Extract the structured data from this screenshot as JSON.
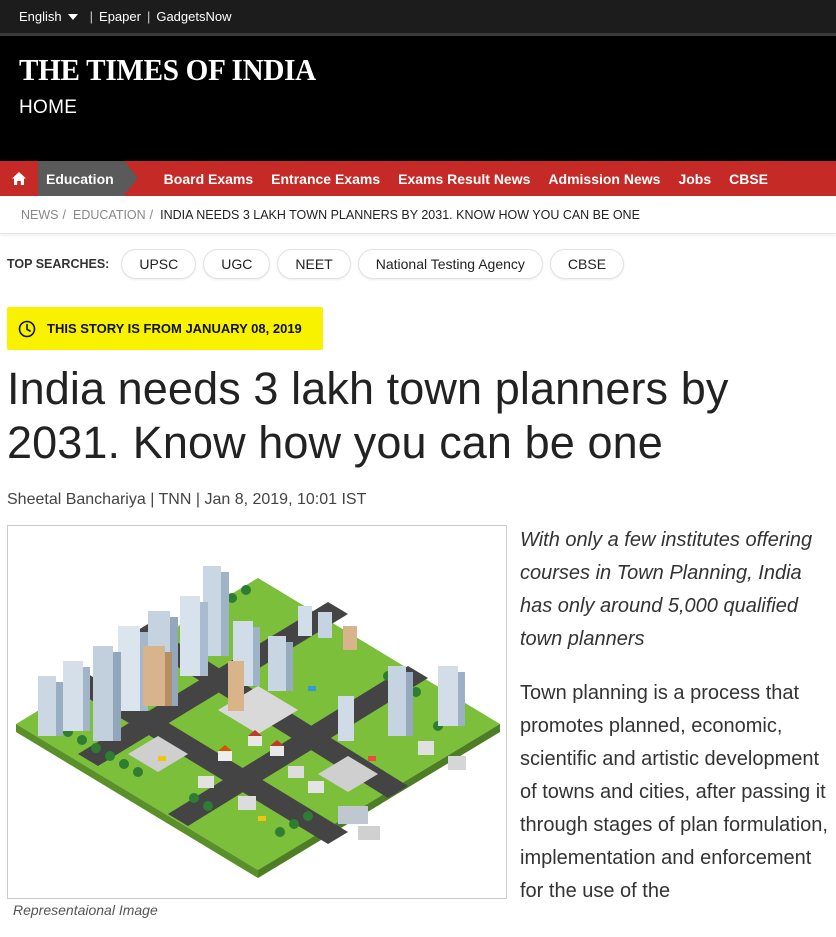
{
  "utilbar": {
    "language": "English",
    "links": [
      "Epaper",
      "GadgetsNow"
    ]
  },
  "masthead": {
    "logo": "THE TIMES OF INDIA",
    "section": "HOME"
  },
  "nav": {
    "active": "Education",
    "items": [
      "Board Exams",
      "Entrance Exams",
      "Exams Result News",
      "Admission News",
      "Jobs",
      "CBSE"
    ]
  },
  "breadcrumb": {
    "items": [
      "NEWS",
      "EDUCATION"
    ],
    "current": "INDIA NEEDS 3 LAKH TOWN PLANNERS BY 2031. KNOW HOW YOU CAN BE ONE"
  },
  "top_searches": {
    "label": "TOP SEARCHES:",
    "items": [
      "UPSC",
      "UGC",
      "NEET",
      "National Testing Agency",
      "CBSE"
    ]
  },
  "story_date": "THIS STORY IS FROM JANUARY 08, 2019",
  "article": {
    "headline": "India needs 3 lakh town planners by 2031. Know how you can be one",
    "byline": "Sheetal Banchariya | TNN | Jan 8, 2019, 10:01 IST",
    "image_caption": "Representaional Image",
    "synopsis": "With only a few institutes offering courses in Town Planning, India has only around 5,000 qualified town planners",
    "body": "Town planning is a process that promotes planned, economic, scientific and artistic development of towns and cities, after passing it through stages of plan formulation, implementation and enforcement for the use of the"
  },
  "colors": {
    "nav_red": "#c62a26",
    "story_date_yellow": "#f8f200",
    "masthead_black": "#000000"
  }
}
